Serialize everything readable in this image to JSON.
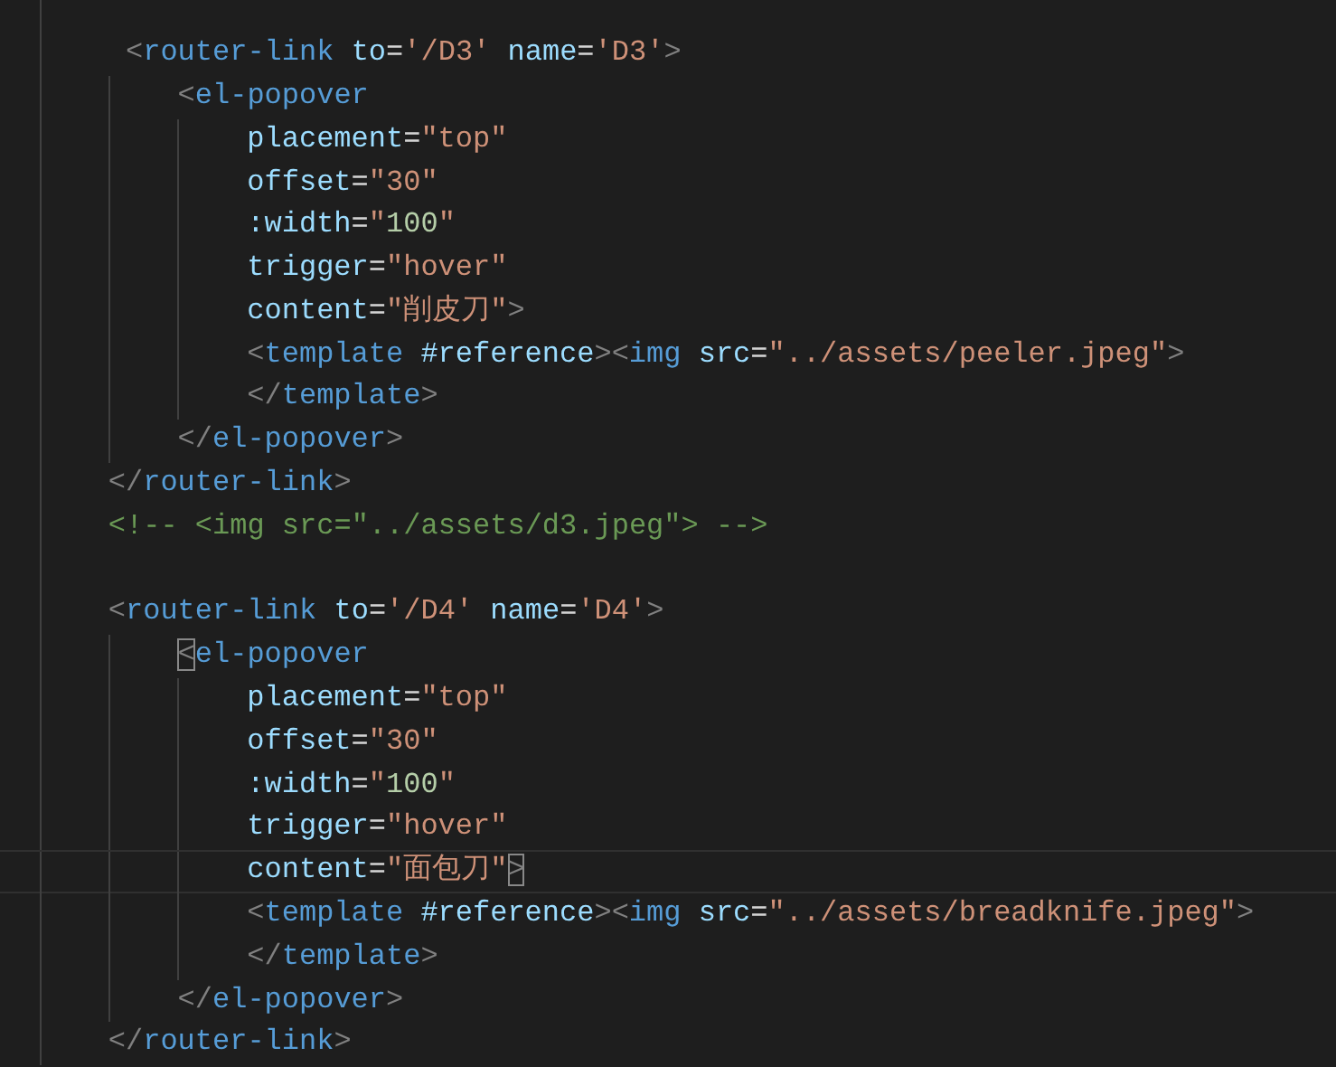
{
  "editor": {
    "lines": [
      {
        "kind": "blank",
        "current": false
      },
      {
        "kind": "code",
        "current": false,
        "tokens": [
          {
            "kind": "punct",
            "text": " <"
          },
          {
            "kind": "tag",
            "text": "router-link"
          },
          {
            "kind": "attr",
            "text": " to"
          },
          {
            "kind": "plain",
            "text": "="
          },
          {
            "kind": "string",
            "text": "'/D3'"
          },
          {
            "kind": "attr",
            "text": " name"
          },
          {
            "kind": "plain",
            "text": "="
          },
          {
            "kind": "string",
            "text": "'D3'"
          },
          {
            "kind": "punct",
            "text": ">"
          }
        ],
        "children": [
          {
            "kind": "code",
            "current": false,
            "tokens": [
              {
                "kind": "punct",
                "text": "<"
              },
              {
                "kind": "tag",
                "text": "el-popover"
              }
            ],
            "children": [
              {
                "kind": "code",
                "current": false,
                "tokens": [
                  {
                    "kind": "attr",
                    "text": "placement"
                  },
                  {
                    "kind": "plain",
                    "text": "="
                  },
                  {
                    "kind": "string",
                    "text": "\"top\""
                  }
                ]
              },
              {
                "kind": "code",
                "current": false,
                "tokens": [
                  {
                    "kind": "attr",
                    "text": "offset"
                  },
                  {
                    "kind": "plain",
                    "text": "="
                  },
                  {
                    "kind": "string",
                    "text": "\"30\""
                  }
                ]
              },
              {
                "kind": "code",
                "current": false,
                "tokens": [
                  {
                    "kind": "attr",
                    "text": ":width"
                  },
                  {
                    "kind": "plain",
                    "text": "="
                  },
                  {
                    "kind": "string",
                    "text": "\""
                  },
                  {
                    "kind": "number",
                    "text": "100"
                  },
                  {
                    "kind": "string",
                    "text": "\""
                  }
                ]
              },
              {
                "kind": "code",
                "current": false,
                "tokens": [
                  {
                    "kind": "attr",
                    "text": "trigger"
                  },
                  {
                    "kind": "plain",
                    "text": "="
                  },
                  {
                    "kind": "string",
                    "text": "\"hover\""
                  }
                ]
              },
              {
                "kind": "code",
                "current": false,
                "tokens": [
                  {
                    "kind": "attr",
                    "text": "content"
                  },
                  {
                    "kind": "plain",
                    "text": "="
                  },
                  {
                    "kind": "string",
                    "text": "\"削皮刀\""
                  },
                  {
                    "kind": "punct",
                    "text": ">"
                  }
                ]
              },
              {
                "kind": "code",
                "current": false,
                "tokens": [
                  {
                    "kind": "punct",
                    "text": "<"
                  },
                  {
                    "kind": "tag",
                    "text": "template"
                  },
                  {
                    "kind": "attr",
                    "text": " #reference"
                  },
                  {
                    "kind": "punct",
                    "text": "><"
                  },
                  {
                    "kind": "tag",
                    "text": "img"
                  },
                  {
                    "kind": "attr",
                    "text": " src"
                  },
                  {
                    "kind": "plain",
                    "text": "="
                  },
                  {
                    "kind": "string",
                    "text": "\"../assets/peeler.jpeg\""
                  },
                  {
                    "kind": "punct",
                    "text": ">"
                  }
                ]
              },
              {
                "kind": "code",
                "current": false,
                "tokens": [
                  {
                    "kind": "punct",
                    "text": "</"
                  },
                  {
                    "kind": "tag",
                    "text": "template"
                  },
                  {
                    "kind": "punct",
                    "text": ">"
                  }
                ]
              }
            ]
          },
          {
            "kind": "code",
            "current": false,
            "tokens": [
              {
                "kind": "punct",
                "text": "</"
              },
              {
                "kind": "tag",
                "text": "el-popover"
              },
              {
                "kind": "punct",
                "text": ">"
              }
            ]
          }
        ]
      },
      {
        "kind": "code",
        "current": false,
        "tokens": [
          {
            "kind": "punct",
            "text": "</"
          },
          {
            "kind": "tag",
            "text": "router-link"
          },
          {
            "kind": "punct",
            "text": ">"
          }
        ]
      },
      {
        "kind": "code",
        "current": false,
        "tokens": [
          {
            "kind": "comment",
            "text": "<!-- <img src=\"../assets/d3.jpeg\"> -->"
          }
        ]
      },
      {
        "kind": "blank",
        "current": false
      },
      {
        "kind": "code",
        "current": false,
        "tokens": [
          {
            "kind": "punct",
            "text": "<"
          },
          {
            "kind": "tag",
            "text": "router-link"
          },
          {
            "kind": "attr",
            "text": " to"
          },
          {
            "kind": "plain",
            "text": "="
          },
          {
            "kind": "string",
            "text": "'/D4'"
          },
          {
            "kind": "attr",
            "text": " name"
          },
          {
            "kind": "plain",
            "text": "="
          },
          {
            "kind": "string",
            "text": "'D4'"
          },
          {
            "kind": "punct",
            "text": ">"
          }
        ],
        "children": [
          {
            "kind": "code",
            "current": false,
            "tokens": [
              {
                "kind": "bracket_match",
                "text": "<"
              },
              {
                "kind": "tag",
                "text": "el-popover"
              }
            ],
            "children": [
              {
                "kind": "code",
                "current": false,
                "tokens": [
                  {
                    "kind": "attr",
                    "text": "placement"
                  },
                  {
                    "kind": "plain",
                    "text": "="
                  },
                  {
                    "kind": "string",
                    "text": "\"top\""
                  }
                ]
              },
              {
                "kind": "code",
                "current": false,
                "tokens": [
                  {
                    "kind": "attr",
                    "text": "offset"
                  },
                  {
                    "kind": "plain",
                    "text": "="
                  },
                  {
                    "kind": "string",
                    "text": "\"30\""
                  }
                ]
              },
              {
                "kind": "code",
                "current": false,
                "tokens": [
                  {
                    "kind": "attr",
                    "text": ":width"
                  },
                  {
                    "kind": "plain",
                    "text": "="
                  },
                  {
                    "kind": "string",
                    "text": "\""
                  },
                  {
                    "kind": "number",
                    "text": "100"
                  },
                  {
                    "kind": "string",
                    "text": "\""
                  }
                ]
              },
              {
                "kind": "code",
                "current": false,
                "tokens": [
                  {
                    "kind": "attr",
                    "text": "trigger"
                  },
                  {
                    "kind": "plain",
                    "text": "="
                  },
                  {
                    "kind": "string",
                    "text": "\"hover\""
                  }
                ]
              },
              {
                "kind": "code",
                "current": true,
                "tokens": [
                  {
                    "kind": "attr",
                    "text": "content"
                  },
                  {
                    "kind": "plain",
                    "text": "="
                  },
                  {
                    "kind": "string",
                    "text": "\"面包刀\""
                  },
                  {
                    "kind": "bracket_match",
                    "text": ">"
                  }
                ]
              },
              {
                "kind": "code",
                "current": false,
                "tokens": [
                  {
                    "kind": "punct",
                    "text": "<"
                  },
                  {
                    "kind": "tag",
                    "text": "template"
                  },
                  {
                    "kind": "attr",
                    "text": " #reference"
                  },
                  {
                    "kind": "punct",
                    "text": "><"
                  },
                  {
                    "kind": "tag",
                    "text": "img"
                  },
                  {
                    "kind": "attr",
                    "text": " src"
                  },
                  {
                    "kind": "plain",
                    "text": "="
                  },
                  {
                    "kind": "string",
                    "text": "\"../assets/breadknife.jpeg\""
                  },
                  {
                    "kind": "punct",
                    "text": ">"
                  }
                ]
              },
              {
                "kind": "code",
                "current": false,
                "tokens": [
                  {
                    "kind": "punct",
                    "text": "</"
                  },
                  {
                    "kind": "tag",
                    "text": "template"
                  },
                  {
                    "kind": "punct",
                    "text": ">"
                  }
                ]
              }
            ]
          },
          {
            "kind": "code",
            "current": false,
            "tokens": [
              {
                "kind": "punct",
                "text": "</"
              },
              {
                "kind": "tag",
                "text": "el-popover"
              },
              {
                "kind": "punct",
                "text": ">"
              }
            ]
          }
        ]
      },
      {
        "kind": "code",
        "current": false,
        "tokens": [
          {
            "kind": "punct",
            "text": "</"
          },
          {
            "kind": "tag",
            "text": "router-link"
          },
          {
            "kind": "punct",
            "text": ">"
          }
        ]
      }
    ]
  }
}
